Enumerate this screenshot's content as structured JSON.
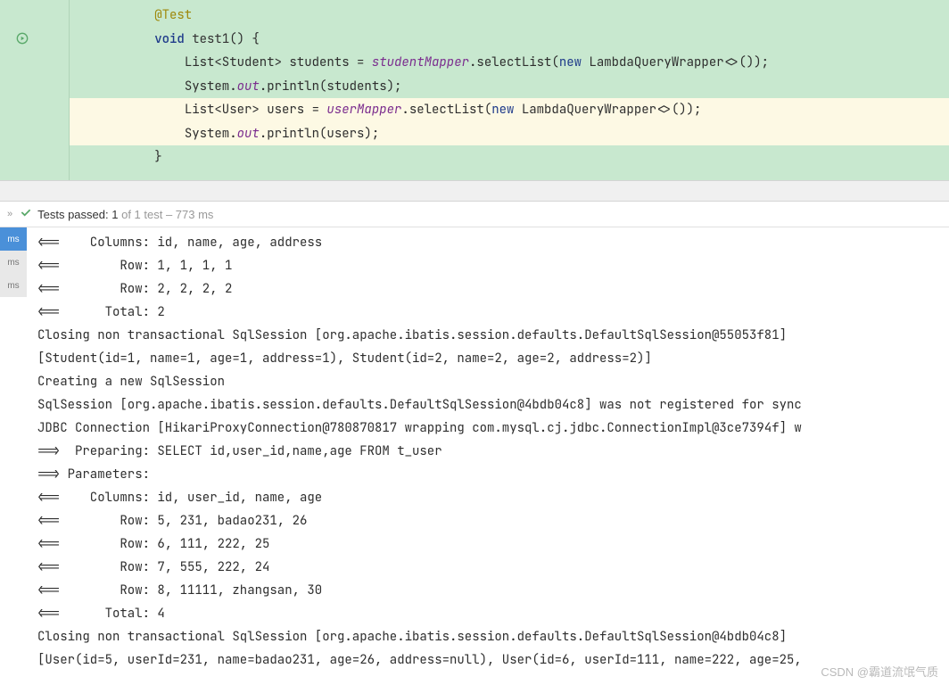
{
  "editor": {
    "gutter": {
      "run_icon": "run-test-icon"
    },
    "lines": [
      {
        "indent": "        ",
        "tokens": [
          {
            "t": "@Test",
            "c": "annotation"
          }
        ]
      },
      {
        "indent": "        ",
        "tokens": [
          {
            "t": "void",
            "c": "keyword"
          },
          {
            "t": " "
          },
          {
            "t": "test1",
            "c": "method-name"
          },
          {
            "t": "() {"
          }
        ]
      },
      {
        "indent": "            ",
        "tokens": [
          {
            "t": "List<Student> students = "
          },
          {
            "t": "studentMapper",
            "c": "field-ref"
          },
          {
            "t": ".selectList("
          },
          {
            "t": "new",
            "c": "new-kw"
          },
          {
            "t": " LambdaQueryWrapper<>());"
          }
        ]
      },
      {
        "indent": "            ",
        "tokens": [
          {
            "t": "System."
          },
          {
            "t": "out",
            "c": "static-field"
          },
          {
            "t": ".println(students);"
          }
        ]
      },
      {
        "indent": "            ",
        "hl": true,
        "tokens": [
          {
            "t": "List<User> users = "
          },
          {
            "t": "userMapper",
            "c": "field-ref"
          },
          {
            "t": ".selectList("
          },
          {
            "t": "new",
            "c": "new-kw"
          },
          {
            "t": " LambdaQueryWrapper<>());"
          }
        ]
      },
      {
        "indent": "            ",
        "hl": true,
        "tokens": [
          {
            "t": "System."
          },
          {
            "t": "out",
            "c": "static-field"
          },
          {
            "t": ".println(users);"
          }
        ]
      },
      {
        "indent": "        ",
        "tokens": [
          {
            "t": "}"
          }
        ]
      }
    ]
  },
  "test_status": {
    "prefix": "Tests passed:",
    "count": "1",
    "of_text": " of 1 test – 773 ms"
  },
  "gutter_badges": {
    "ms_label": "ms"
  },
  "console": {
    "lines": [
      "<==    Columns: id, name, age, address",
      "<==        Row: 1, 1, 1, 1",
      "<==        Row: 2, 2, 2, 2",
      "<==      Total: 2",
      "Closing non transactional SqlSession [org.apache.ibatis.session.defaults.DefaultSqlSession@55053f81]",
      "[Student(id=1, name=1, age=1, address=1), Student(id=2, name=2, age=2, address=2)]",
      "Creating a new SqlSession",
      "SqlSession [org.apache.ibatis.session.defaults.DefaultSqlSession@4bdb04c8] was not registered for sync",
      "JDBC Connection [HikariProxyConnection@780870817 wrapping com.mysql.cj.jdbc.ConnectionImpl@3ce7394f] w",
      "==>  Preparing: SELECT id,user_id,name,age FROM t_user",
      "==> Parameters:",
      "<==    Columns: id, user_id, name, age",
      "<==        Row: 5, 231, badao231, 26",
      "<==        Row: 6, 111, 222, 25",
      "<==        Row: 7, 555, 222, 24",
      "<==        Row: 8, 11111, zhangsan, 30",
      "<==      Total: 4",
      "Closing non transactional SqlSession [org.apache.ibatis.session.defaults.DefaultSqlSession@4bdb04c8]",
      "[User(id=5, userId=231, name=badao231, age=26, address=null), User(id=6, userId=111, name=222, age=25,"
    ]
  },
  "watermark": "CSDN @霸道流氓气质"
}
